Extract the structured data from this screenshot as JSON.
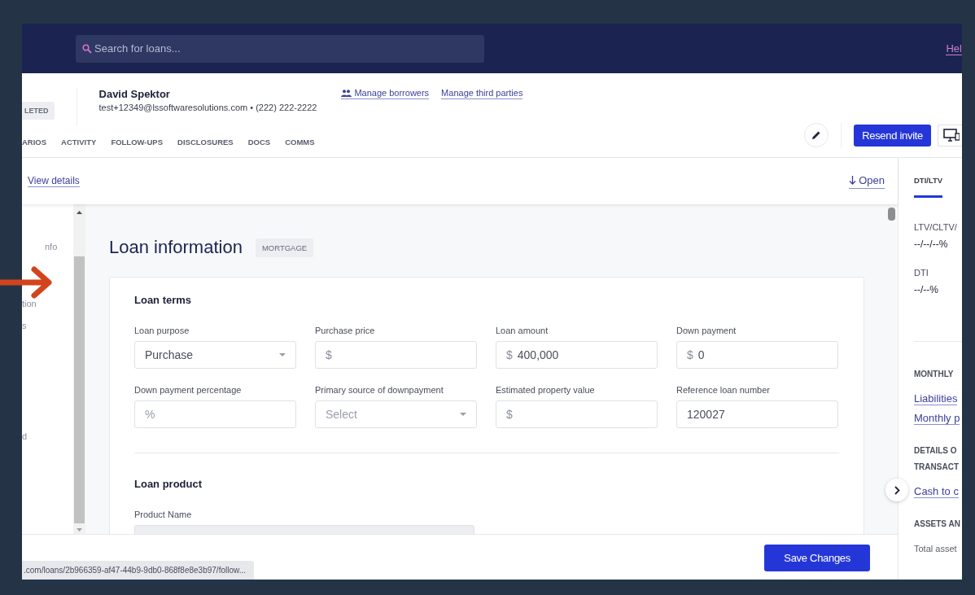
{
  "navbar": {
    "search_placeholder": "Search for loans...",
    "help_link": "Hel"
  },
  "borrower": {
    "status_badge": "LETED",
    "name": "David Spektor",
    "contact": "test+12349@lssoftwaresolutions.com • (222) 222-2222",
    "links": [
      "Manage borrowers",
      "Manage third parties"
    ]
  },
  "tabs": [
    {
      "label": "ARIOS",
      "selected": false
    },
    {
      "label": "ACTIVITY",
      "selected": false
    },
    {
      "label": "FOLLOW-UPS",
      "selected": false
    },
    {
      "label": "DISCLOSURES",
      "selected": false
    },
    {
      "label": "DOCS",
      "selected": false
    },
    {
      "label": "COMMS",
      "selected": false
    }
  ],
  "actions": {
    "resend_button": "Resend invite"
  },
  "subbar": {
    "view_details": "View details",
    "open_link": "Open"
  },
  "left_nav": [
    "nfo",
    "tion",
    "s",
    "d"
  ],
  "loan_info": {
    "title": "Loan information",
    "badge": "MORTGAGE",
    "sections": [
      {
        "title": "Loan terms",
        "fields": [
          {
            "label": "Loan purpose",
            "kind": "select",
            "value": "Purchase"
          },
          {
            "label": "Purchase price",
            "kind": "currency",
            "prefix": "$"
          },
          {
            "label": "Loan amount",
            "kind": "currency",
            "prefix": "$",
            "value": "400,000"
          },
          {
            "label": "Down payment",
            "kind": "currency",
            "prefix": "$",
            "value": "0"
          },
          {
            "label": "Down payment percentage",
            "kind": "text",
            "placeholder": "%"
          },
          {
            "label": "Primary source of downpayment",
            "kind": "select",
            "placeholder": "Select"
          },
          {
            "label": "Estimated property value",
            "kind": "currency",
            "prefix": "$"
          },
          {
            "label": "Reference loan number",
            "kind": "text",
            "value": "120027"
          }
        ]
      },
      {
        "title": "Loan product",
        "fields": [
          {
            "label": "Product Name",
            "kind": "readonly"
          }
        ]
      }
    ]
  },
  "right_panel": {
    "tabs": [
      {
        "label": "DTI/LTV",
        "selected": true
      }
    ],
    "metrics": [
      {
        "label": "LTV/CLTV/",
        "value": "--/--/--%"
      },
      {
        "label": "DTI",
        "value": "--/--%"
      }
    ],
    "sections": [
      {
        "heading": [
          "MONTHLY"
        ],
        "items": [
          {
            "kind": "link",
            "text": "Liabilities"
          },
          {
            "kind": "link",
            "text": "Monthly p"
          }
        ]
      },
      {
        "heading": [
          "DETAILS O",
          "TRANSACT"
        ],
        "items": [
          {
            "kind": "link",
            "text": "Cash to c"
          }
        ]
      },
      {
        "heading": [
          "ASSETS AN"
        ],
        "items": [
          {
            "kind": "text",
            "text": "Total asset"
          }
        ]
      }
    ]
  },
  "bottom": {
    "save_button": "Save Changes",
    "status_url": ".com/loans/2b966359-af47-44b9-9db0-868f8e8e3b97/follow..."
  }
}
